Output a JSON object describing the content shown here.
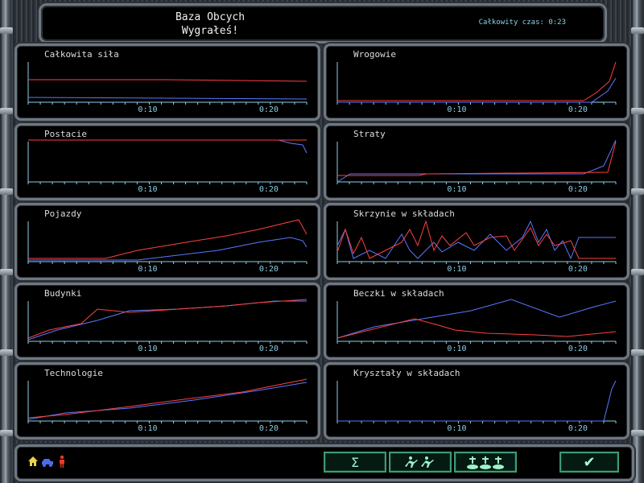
{
  "header": {
    "title_line1": "Baza Obcych",
    "title_line2": "Wygrałeś!",
    "total_time": "Całkowity czas: 0:23"
  },
  "panels": [
    {
      "key": "total_strength",
      "label": "Całkowita siła"
    },
    {
      "key": "enemies",
      "label": "Wrogowie"
    },
    {
      "key": "characters",
      "label": "Postacie"
    },
    {
      "key": "losses",
      "label": "Straty"
    },
    {
      "key": "vehicles",
      "label": "Pojazdy"
    },
    {
      "key": "crates",
      "label": "Skrzynie w składach"
    },
    {
      "key": "buildings",
      "label": "Budynki"
    },
    {
      "key": "barrels",
      "label": "Beczki w składach"
    },
    {
      "key": "technology",
      "label": "Technologie"
    },
    {
      "key": "crystals",
      "label": "Kryształy w składach"
    }
  ],
  "tick_labels": [
    "0:10",
    "0:20"
  ],
  "series_colors": {
    "red": "#ff4040",
    "blue": "#5a78ff"
  },
  "footer": {
    "buttons": [
      {
        "name": "sum-button",
        "icon": "sigma-icon",
        "glyph": "Σ"
      },
      {
        "name": "units-button",
        "icon": "soldiers-icon",
        "glyph": ""
      },
      {
        "name": "graves-button",
        "icon": "graves-icon",
        "glyph": ""
      },
      {
        "name": "ok-button",
        "icon": "checkmark-icon",
        "glyph": "✔"
      }
    ],
    "left_icons": [
      "home-icon",
      "vehicle-icon",
      "soldier-icon"
    ]
  }
}
